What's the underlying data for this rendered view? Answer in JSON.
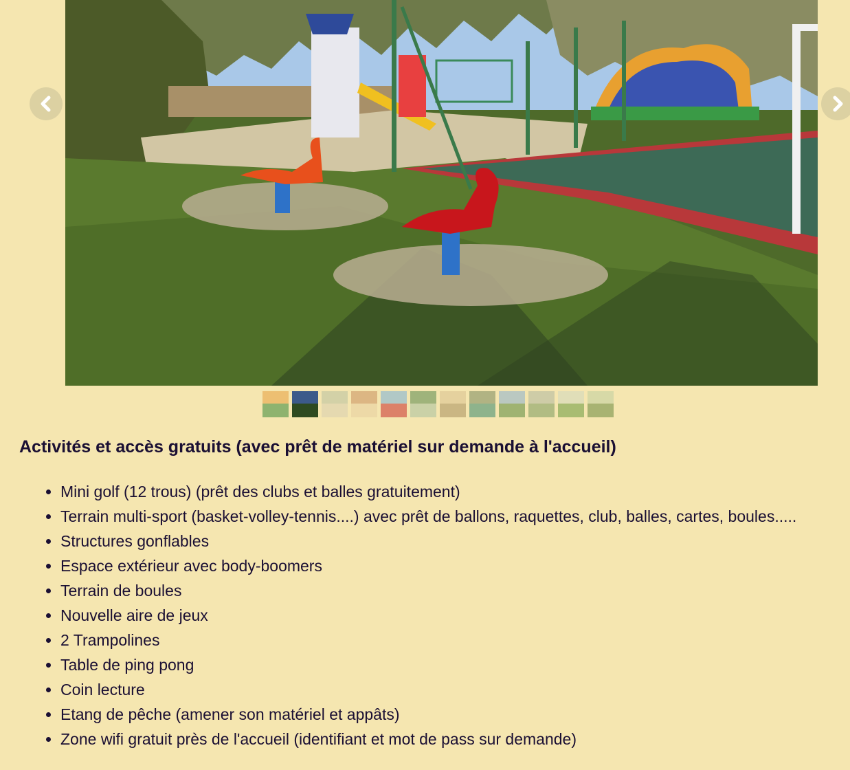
{
  "slider": {
    "prev_icon": "chevron-left-icon",
    "next_icon": "chevron-right-icon",
    "slide_image": "playground-photo",
    "thumbnails": [
      {
        "name": "inflatable",
        "active": false,
        "colors": [
          "#e8a040",
          "#3b8a3a"
        ]
      },
      {
        "name": "pond",
        "active": true,
        "colors": [
          "#3c5a8a",
          "#2e4a20"
        ]
      },
      {
        "name": "minigolf",
        "active": false,
        "colors": [
          "#b8c0a0",
          "#d8d0b0"
        ]
      },
      {
        "name": "lounge",
        "active": false,
        "colors": [
          "#c89060",
          "#e8d0a0"
        ]
      },
      {
        "name": "trampoline",
        "active": false,
        "colors": [
          "#7ab0d8",
          "#c83030"
        ]
      },
      {
        "name": "court",
        "active": false,
        "colors": [
          "#5a8a50",
          "#a8c0a0"
        ]
      },
      {
        "name": "room",
        "active": false,
        "colors": [
          "#d8c090",
          "#a89060"
        ]
      },
      {
        "name": "pingpong",
        "active": false,
        "colors": [
          "#7a8a60",
          "#3a8a70"
        ]
      },
      {
        "name": "field",
        "active": false,
        "colors": [
          "#8ab0d0",
          "#5a8a40"
        ]
      },
      {
        "name": "boules",
        "active": false,
        "colors": [
          "#b0b8a0",
          "#7a9a60"
        ]
      },
      {
        "name": "lawn",
        "active": false,
        "colors": [
          "#d0d8c0",
          "#6a9a40"
        ]
      },
      {
        "name": "garden",
        "active": false,
        "colors": [
          "#c0d0a0",
          "#6a8a40"
        ]
      }
    ]
  },
  "section": {
    "title": "Activités et accès gratuits (avec prêt de matériel sur demande à l'accueil)"
  },
  "activities": [
    "Mini golf (12 trous) (prêt des clubs et balles gratuitement)",
    "Terrain multi-sport (basket-volley-tennis....) avec prêt de ballons, raquettes, club, balles, cartes, boules.....",
    "Structures gonflables",
    "Espace extérieur avec body-boomers",
    "Terrain de boules",
    "Nouvelle aire de jeux",
    "2 Trampolines",
    "Table de ping pong",
    "Coin lecture",
    "Etang de pêche (amener son matériel et appâts)",
    "Zone wifi gratuit près de l'accueil (identifiant et mot de pass sur demande)"
  ],
  "colors": {
    "background": "#f5e6b0",
    "text": "#1a0f33"
  }
}
